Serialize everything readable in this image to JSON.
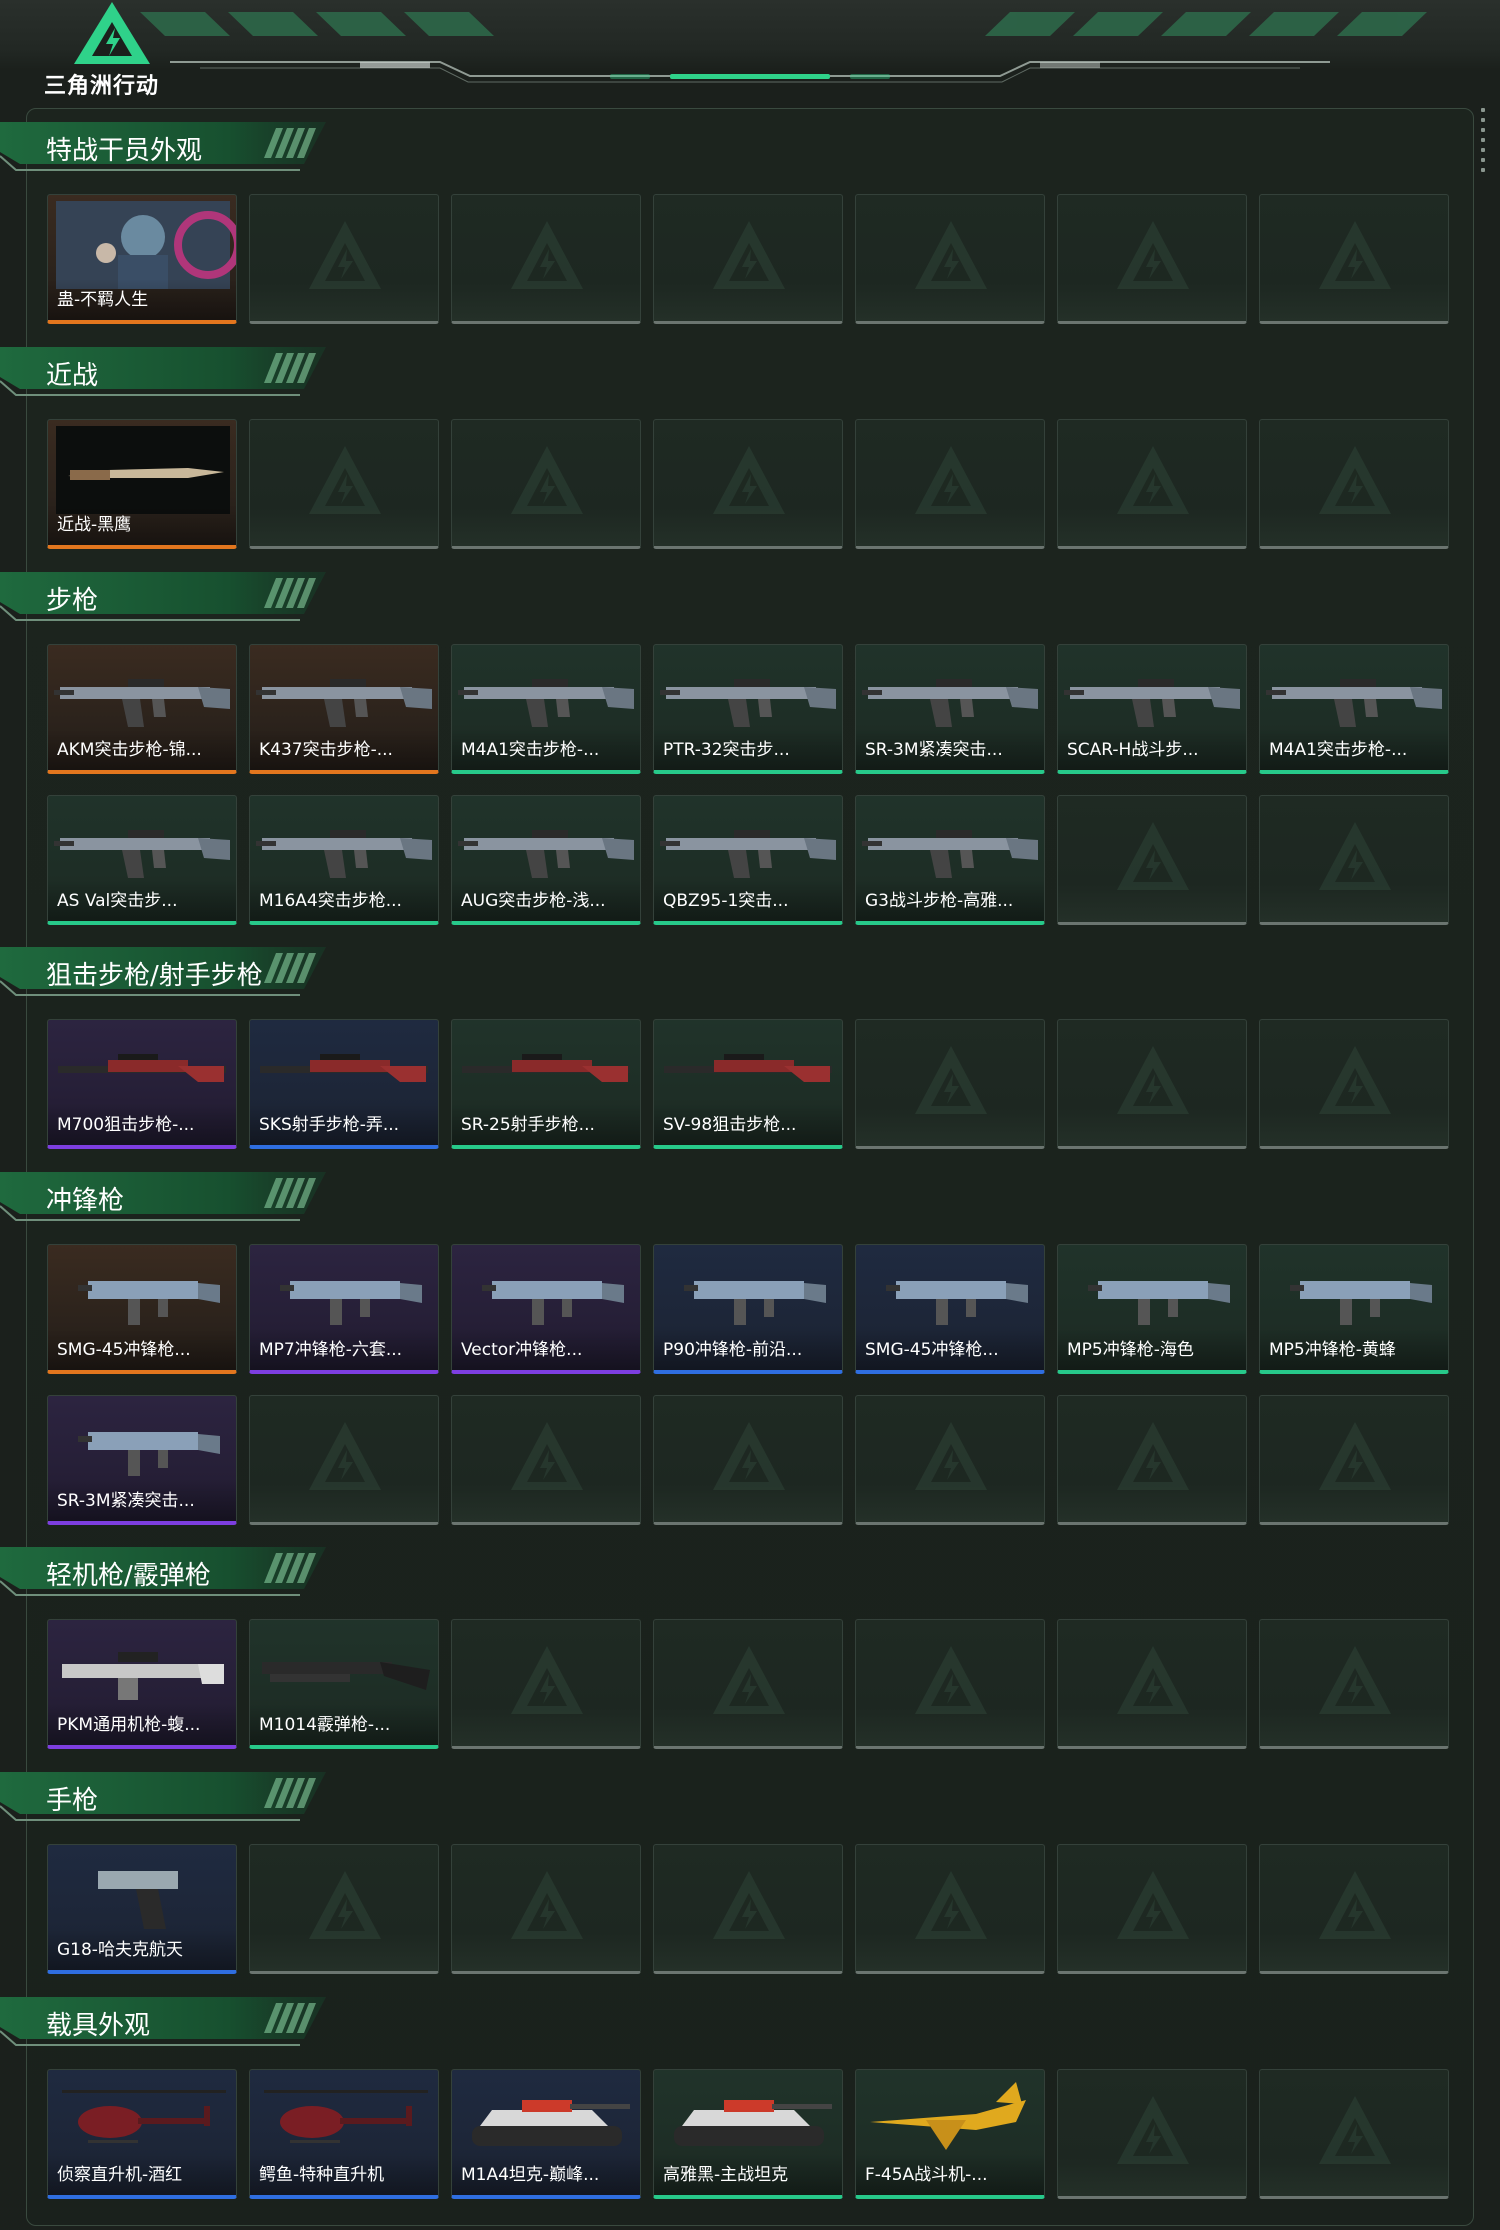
{
  "app": {
    "logo_text": "三角洲行动"
  },
  "colors": {
    "gold": "#e2761e",
    "purple": "#7d3ee0",
    "blue": "#2f6ee0",
    "green": "#27c98a",
    "accent": "#2fd28a"
  },
  "sections": [
    {
      "title": "特战干员外观",
      "rows": [
        [
          {
            "label": "蛊-不羁人生",
            "rarity": "gold",
            "icon": "operator-portrait"
          }
        ]
      ]
    },
    {
      "title": "近战",
      "rows": [
        [
          {
            "label": "近战-黑鹰",
            "rarity": "gold",
            "icon": "knife"
          }
        ]
      ]
    },
    {
      "title": "步枪",
      "rows": [
        [
          {
            "label": "AKM突击步枪-锦...",
            "rarity": "gold",
            "icon": "rifle"
          },
          {
            "label": "K437突击步枪-...",
            "rarity": "gold",
            "icon": "rifle"
          },
          {
            "label": "M4A1突击步枪-...",
            "rarity": "green",
            "icon": "rifle"
          },
          {
            "label": "PTR-32突击步...",
            "rarity": "green",
            "icon": "rifle"
          },
          {
            "label": "SR-3M紧凑突击...",
            "rarity": "green",
            "icon": "rifle"
          },
          {
            "label": "SCAR-H战斗步...",
            "rarity": "green",
            "icon": "rifle"
          },
          {
            "label": "M4A1突击步枪-...",
            "rarity": "green",
            "icon": "rifle"
          }
        ],
        [
          {
            "label": "AS Val突击步...",
            "rarity": "green",
            "icon": "rifle"
          },
          {
            "label": "M16A4突击步枪...",
            "rarity": "green",
            "icon": "rifle"
          },
          {
            "label": "AUG突击步枪-浅...",
            "rarity": "green",
            "icon": "rifle"
          },
          {
            "label": "QBZ95-1突击...",
            "rarity": "green",
            "icon": "rifle"
          },
          {
            "label": "G3战斗步枪-高雅...",
            "rarity": "green",
            "icon": "rifle"
          }
        ]
      ]
    },
    {
      "title": "狙击步枪/射手步枪",
      "rows": [
        [
          {
            "label": "M700狙击步枪-...",
            "rarity": "purple",
            "icon": "sniper"
          },
          {
            "label": "SKS射手步枪-弄...",
            "rarity": "blue",
            "icon": "sniper"
          },
          {
            "label": "SR-25射手步枪...",
            "rarity": "green",
            "icon": "sniper"
          },
          {
            "label": "SV-98狙击步枪...",
            "rarity": "green",
            "icon": "sniper"
          }
        ]
      ]
    },
    {
      "title": "冲锋枪",
      "rows": [
        [
          {
            "label": "SMG-45冲锋枪...",
            "rarity": "gold",
            "icon": "smg"
          },
          {
            "label": "MP7冲锋枪-六套...",
            "rarity": "purple",
            "icon": "smg"
          },
          {
            "label": "Vector冲锋枪...",
            "rarity": "purple",
            "icon": "smg"
          },
          {
            "label": "P90冲锋枪-前沿...",
            "rarity": "blue",
            "icon": "smg"
          },
          {
            "label": "SMG-45冲锋枪...",
            "rarity": "blue",
            "icon": "smg"
          },
          {
            "label": "MP5冲锋枪-海色",
            "rarity": "green",
            "icon": "smg"
          },
          {
            "label": "MP5冲锋枪-黄蜂",
            "rarity": "green",
            "icon": "smg"
          }
        ],
        [
          {
            "label": "SR-3M紧凑突击...",
            "rarity": "purple",
            "icon": "smg"
          }
        ]
      ]
    },
    {
      "title": "轻机枪/霰弹枪",
      "rows": [
        [
          {
            "label": "PKM通用机枪-蝮...",
            "rarity": "purple",
            "icon": "lmg"
          },
          {
            "label": "M1014霰弹枪-...",
            "rarity": "green",
            "icon": "shotgun"
          }
        ]
      ]
    },
    {
      "title": "手枪",
      "rows": [
        [
          {
            "label": "G18-哈夫克航天",
            "rarity": "blue",
            "icon": "pistol"
          }
        ]
      ]
    },
    {
      "title": "载具外观",
      "rows": [
        [
          {
            "label": "侦察直升机-酒红",
            "rarity": "blue",
            "icon": "helicopter"
          },
          {
            "label": "鳄鱼-特种直升机",
            "rarity": "blue",
            "icon": "helicopter"
          },
          {
            "label": "M1A4坦克-巅峰...",
            "rarity": "blue",
            "icon": "tank"
          },
          {
            "label": "高雅黑-主战坦克",
            "rarity": "green",
            "icon": "tank"
          },
          {
            "label": "F-45A战斗机-...",
            "rarity": "green",
            "icon": "jet"
          }
        ]
      ]
    }
  ]
}
